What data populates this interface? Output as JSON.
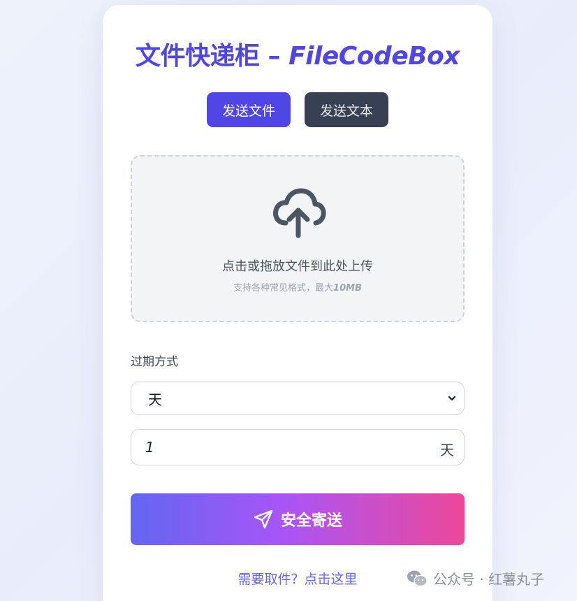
{
  "header": {
    "title_cn": "文件快递柜 – ",
    "title_en": "FileCodeBox"
  },
  "tabs": [
    {
      "label": "发送文件",
      "active": true
    },
    {
      "label": "发送文本",
      "active": false
    }
  ],
  "dropzone": {
    "icon": "cloud-upload-icon",
    "main_text": "点击或拖放文件到此处上传",
    "sub_text": "支持各种常见格式，最大",
    "max_size": "10MB"
  },
  "expire": {
    "label": "过期方式",
    "selected": "天",
    "value": "1",
    "unit": "天"
  },
  "send_button": {
    "icon": "paper-plane-icon",
    "label": "安全寄送"
  },
  "retrieve_link": "需要取件？点击这里",
  "watermark": {
    "icon": "wechat-icon",
    "text": "公众号 · 红薯丸子"
  },
  "colors": {
    "accent": "#4f46e5",
    "dark_tab": "#374151",
    "gradient_start": "#6366f1",
    "gradient_mid": "#a855f7",
    "gradient_end": "#ec4899"
  }
}
